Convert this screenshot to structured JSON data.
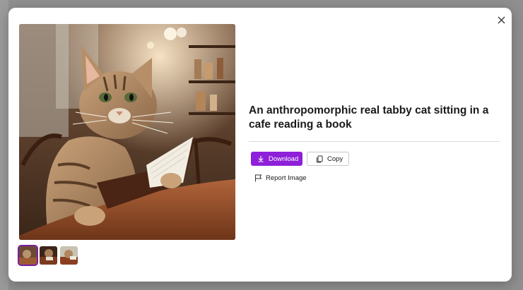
{
  "prompt_title": "An anthropomorphic real tabby cat sitting in a cafe reading a book",
  "actions": {
    "download_label": "Download",
    "copy_label": "Copy",
    "report_label": "Report Image"
  },
  "icons": {
    "close": "close-icon",
    "download": "download-icon",
    "copy": "copy-icon",
    "report": "flag-icon"
  },
  "colors": {
    "accent": "#8e20d9",
    "selected_thumb_border": "#7b1fa2"
  },
  "thumbnails": [
    {
      "selected": true
    },
    {
      "selected": false
    },
    {
      "selected": false
    }
  ]
}
